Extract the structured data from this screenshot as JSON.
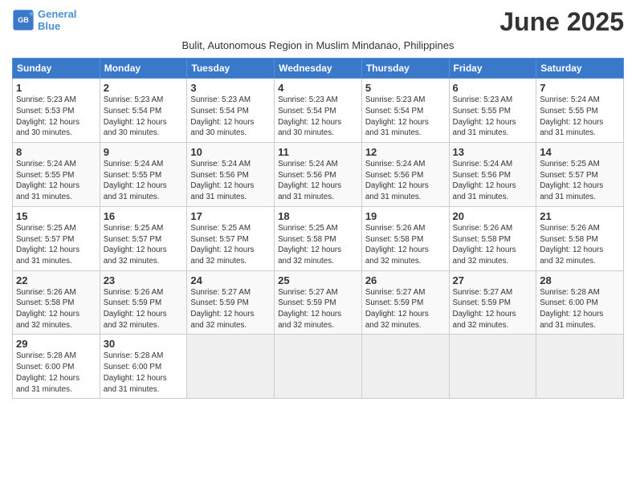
{
  "logo": {
    "line1": "General",
    "line2": "Blue"
  },
  "title": "June 2025",
  "subtitle": "Bulit, Autonomous Region in Muslim Mindanao, Philippines",
  "days_of_week": [
    "Sunday",
    "Monday",
    "Tuesday",
    "Wednesday",
    "Thursday",
    "Friday",
    "Saturday"
  ],
  "weeks": [
    [
      {
        "day": "1",
        "info": "Sunrise: 5:23 AM\nSunset: 5:53 PM\nDaylight: 12 hours\nand 30 minutes."
      },
      {
        "day": "2",
        "info": "Sunrise: 5:23 AM\nSunset: 5:54 PM\nDaylight: 12 hours\nand 30 minutes."
      },
      {
        "day": "3",
        "info": "Sunrise: 5:23 AM\nSunset: 5:54 PM\nDaylight: 12 hours\nand 30 minutes."
      },
      {
        "day": "4",
        "info": "Sunrise: 5:23 AM\nSunset: 5:54 PM\nDaylight: 12 hours\nand 30 minutes."
      },
      {
        "day": "5",
        "info": "Sunrise: 5:23 AM\nSunset: 5:54 PM\nDaylight: 12 hours\nand 31 minutes."
      },
      {
        "day": "6",
        "info": "Sunrise: 5:23 AM\nSunset: 5:55 PM\nDaylight: 12 hours\nand 31 minutes."
      },
      {
        "day": "7",
        "info": "Sunrise: 5:24 AM\nSunset: 5:55 PM\nDaylight: 12 hours\nand 31 minutes."
      }
    ],
    [
      {
        "day": "8",
        "info": "Sunrise: 5:24 AM\nSunset: 5:55 PM\nDaylight: 12 hours\nand 31 minutes."
      },
      {
        "day": "9",
        "info": "Sunrise: 5:24 AM\nSunset: 5:55 PM\nDaylight: 12 hours\nand 31 minutes."
      },
      {
        "day": "10",
        "info": "Sunrise: 5:24 AM\nSunset: 5:56 PM\nDaylight: 12 hours\nand 31 minutes."
      },
      {
        "day": "11",
        "info": "Sunrise: 5:24 AM\nSunset: 5:56 PM\nDaylight: 12 hours\nand 31 minutes."
      },
      {
        "day": "12",
        "info": "Sunrise: 5:24 AM\nSunset: 5:56 PM\nDaylight: 12 hours\nand 31 minutes."
      },
      {
        "day": "13",
        "info": "Sunrise: 5:24 AM\nSunset: 5:56 PM\nDaylight: 12 hours\nand 31 minutes."
      },
      {
        "day": "14",
        "info": "Sunrise: 5:25 AM\nSunset: 5:57 PM\nDaylight: 12 hours\nand 31 minutes."
      }
    ],
    [
      {
        "day": "15",
        "info": "Sunrise: 5:25 AM\nSunset: 5:57 PM\nDaylight: 12 hours\nand 31 minutes."
      },
      {
        "day": "16",
        "info": "Sunrise: 5:25 AM\nSunset: 5:57 PM\nDaylight: 12 hours\nand 32 minutes."
      },
      {
        "day": "17",
        "info": "Sunrise: 5:25 AM\nSunset: 5:57 PM\nDaylight: 12 hours\nand 32 minutes."
      },
      {
        "day": "18",
        "info": "Sunrise: 5:25 AM\nSunset: 5:58 PM\nDaylight: 12 hours\nand 32 minutes."
      },
      {
        "day": "19",
        "info": "Sunrise: 5:26 AM\nSunset: 5:58 PM\nDaylight: 12 hours\nand 32 minutes."
      },
      {
        "day": "20",
        "info": "Sunrise: 5:26 AM\nSunset: 5:58 PM\nDaylight: 12 hours\nand 32 minutes."
      },
      {
        "day": "21",
        "info": "Sunrise: 5:26 AM\nSunset: 5:58 PM\nDaylight: 12 hours\nand 32 minutes."
      }
    ],
    [
      {
        "day": "22",
        "info": "Sunrise: 5:26 AM\nSunset: 5:58 PM\nDaylight: 12 hours\nand 32 minutes."
      },
      {
        "day": "23",
        "info": "Sunrise: 5:26 AM\nSunset: 5:59 PM\nDaylight: 12 hours\nand 32 minutes."
      },
      {
        "day": "24",
        "info": "Sunrise: 5:27 AM\nSunset: 5:59 PM\nDaylight: 12 hours\nand 32 minutes."
      },
      {
        "day": "25",
        "info": "Sunrise: 5:27 AM\nSunset: 5:59 PM\nDaylight: 12 hours\nand 32 minutes."
      },
      {
        "day": "26",
        "info": "Sunrise: 5:27 AM\nSunset: 5:59 PM\nDaylight: 12 hours\nand 32 minutes."
      },
      {
        "day": "27",
        "info": "Sunrise: 5:27 AM\nSunset: 5:59 PM\nDaylight: 12 hours\nand 32 minutes."
      },
      {
        "day": "28",
        "info": "Sunrise: 5:28 AM\nSunset: 6:00 PM\nDaylight: 12 hours\nand 31 minutes."
      }
    ],
    [
      {
        "day": "29",
        "info": "Sunrise: 5:28 AM\nSunset: 6:00 PM\nDaylight: 12 hours\nand 31 minutes."
      },
      {
        "day": "30",
        "info": "Sunrise: 5:28 AM\nSunset: 6:00 PM\nDaylight: 12 hours\nand 31 minutes."
      },
      {
        "day": "",
        "info": ""
      },
      {
        "day": "",
        "info": ""
      },
      {
        "day": "",
        "info": ""
      },
      {
        "day": "",
        "info": ""
      },
      {
        "day": "",
        "info": ""
      }
    ]
  ]
}
